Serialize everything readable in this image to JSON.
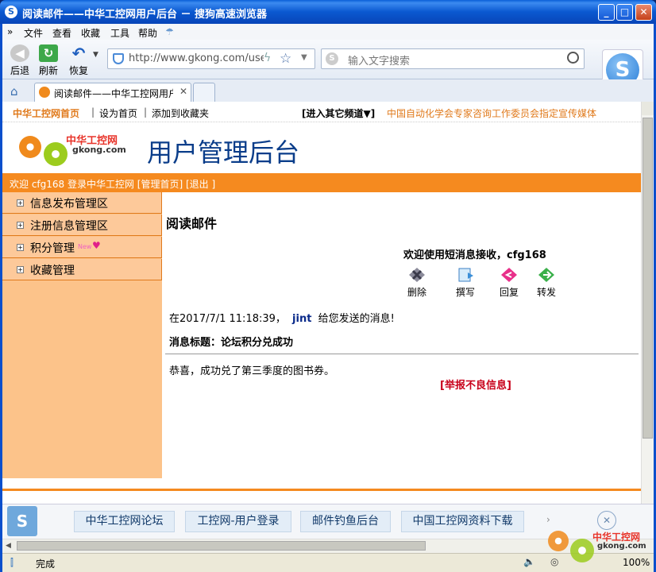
{
  "window": {
    "title": "阅读邮件——中华工控网用户后台 － 搜狗高速浏览器",
    "app_logo": "S",
    "controls": {
      "minimize": "_",
      "maximize": "□",
      "close": "✕"
    }
  },
  "menu": {
    "chevron": "»",
    "items": [
      "文件",
      "查看",
      "收藏",
      "工具",
      "帮助"
    ]
  },
  "toolbar": {
    "back_label": "后退",
    "refresh_label": "刷新",
    "restore_label": "恢复"
  },
  "address": {
    "url": "http://www.gkong.com/use"
  },
  "search": {
    "placeholder": "输入文字搜索",
    "logo": "S"
  },
  "tabs": [
    {
      "label": "阅读邮件——中华工控网用户"
    }
  ],
  "site": {
    "top_nav": {
      "home_link": "中华工控网首页",
      "sep": "|",
      "set_home": "设为首页",
      "add_favorite": "添加到收藏夹",
      "channels": "[进入其它频道▼]",
      "slogan": "中国自动化学会专家咨询工作委员会指定宣传媒体"
    },
    "logo": {
      "name": "中华工控网",
      "domain": "gkong.com"
    },
    "header_title": "用户管理后台",
    "welcome_bar": "欢迎 cfg168 登录中华工控网 [管理首页] [退出 ]",
    "sidebar": [
      {
        "label": "信息发布管理区"
      },
      {
        "label": "注册信息管理区"
      },
      {
        "label": "积分管理",
        "badge": "New"
      },
      {
        "label": "收藏管理"
      }
    ],
    "content": {
      "heading": "阅读邮件",
      "greeting": "欢迎使用短消息接收，cfg168",
      "actions": [
        "删除",
        "撰写",
        "回复",
        "转发"
      ],
      "message_prefix": "在2017/7/1 11:18:39，",
      "sender": "jint",
      "message_suffix": "给您发送的消息!",
      "subject_line": "消息标题：论坛积分兑成功",
      "body": "恭喜，成功兑了第三季度的图书券。",
      "report_link": "[举报不良信息]"
    }
  },
  "bookmarks": [
    {
      "label": "中华工控网论坛"
    },
    {
      "label": "工控网-用户登录"
    },
    {
      "label": "邮件钓鱼后台"
    },
    {
      "label": "中国工控网资料下载"
    }
  ],
  "status": {
    "text": "完成",
    "zoom": "100%"
  },
  "watermark": {
    "name": "中华工控网",
    "domain": "gkong.com"
  },
  "colors": {
    "accent_orange": "#f58a1f",
    "sidebar_bg": "#fdc99a",
    "header_blue": "#0a3d8a",
    "report_red": "#c8001a"
  }
}
